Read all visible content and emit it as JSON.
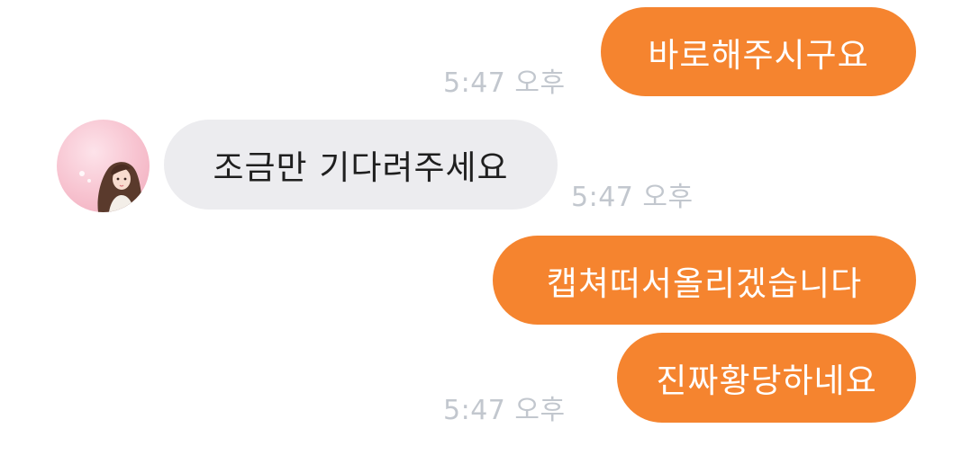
{
  "chat": {
    "messages": [
      {
        "direction": "outgoing",
        "text": "바로해주시구요",
        "time": "5:47 오후"
      },
      {
        "direction": "incoming",
        "text": "조금만 기다려주세요",
        "time": "5:47 오후"
      },
      {
        "direction": "outgoing",
        "text": "캡쳐떠서올리겠습니다",
        "time": ""
      },
      {
        "direction": "outgoing",
        "text": "진짜황당하네요",
        "time": "5:47 오후"
      }
    ]
  },
  "colors": {
    "outgoing_bubble": "#f5842f",
    "incoming_bubble": "#ececef",
    "timestamp": "#c2c7ce"
  },
  "icons": {
    "avatar": "profile-avatar-illustrated-girl"
  }
}
